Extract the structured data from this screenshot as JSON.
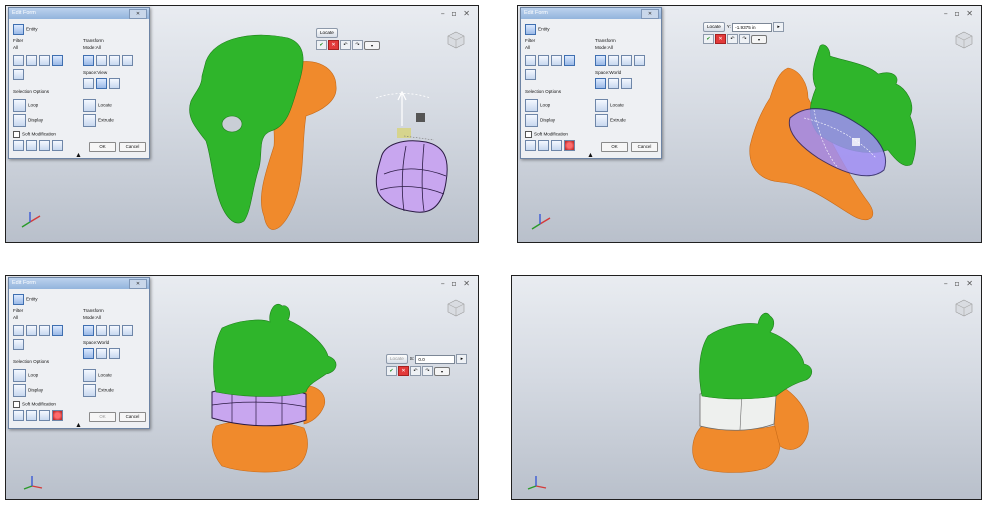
{
  "panels": [
    {
      "id": "top-left",
      "dialog": {
        "title": "Edit Form",
        "entity": "Entity",
        "filter_label": "Filter",
        "filter_value": "All",
        "transform_label": "Transform",
        "mode": "Mode:All",
        "space_label": "Space:View",
        "selection_label": "Selection Options",
        "loop": "Loop",
        "display": "Display",
        "locate": "Locate",
        "extrude": "Extrude",
        "soft_mod": "Soft Modification",
        "ok": "OK",
        "cancel": "Cancel"
      },
      "minibar": {
        "locate": "Locate"
      }
    },
    {
      "id": "top-right",
      "dialog": {
        "title": "Edit Form",
        "entity": "Entity",
        "filter_label": "Filter",
        "filter_value": "All",
        "transform_label": "Transform",
        "mode": "Mode:All",
        "space_label": "Space:World",
        "selection_label": "Selection Options",
        "loop": "Loop",
        "display": "Display",
        "locate": "Locate",
        "extrude": "Extrude",
        "soft_mod": "Soft Modification",
        "ok": "OK",
        "cancel": "Cancel"
      },
      "minibar": {
        "locate": "Locate",
        "axis": "Y:",
        "value": "-1.9375 in"
      }
    },
    {
      "id": "bottom-left",
      "dialog": {
        "title": "Edit Form",
        "entity": "Entity",
        "filter_label": "Filter",
        "filter_value": "All",
        "transform_label": "Transform",
        "mode": "Mode:All",
        "space_label": "Space:World",
        "selection_label": "Selection Options",
        "loop": "Loop",
        "display": "Display",
        "locate": "Locate",
        "extrude": "Extrude",
        "soft_mod": "Soft Modification",
        "ok": "OK",
        "cancel": "Cancel"
      },
      "minibar": {
        "locate": "Locate",
        "axis": "S:",
        "value": "0.0"
      }
    },
    {
      "id": "bottom-right"
    }
  ],
  "colors": {
    "vertebra_green": "#2fb52b",
    "vertebra_orange": "#f08a2c",
    "edit_form_purple": "#c8a6ef",
    "cancel_red": "#e23a3a"
  }
}
